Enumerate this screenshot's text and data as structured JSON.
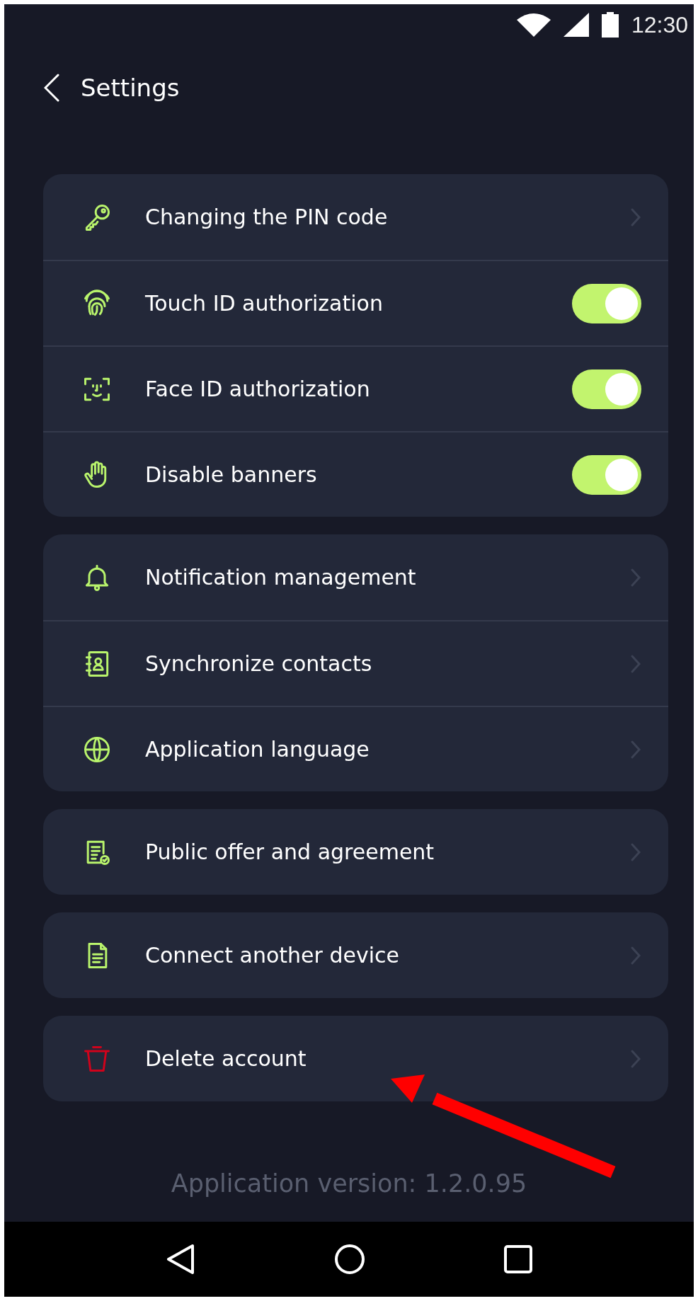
{
  "status_bar": {
    "time": "12:30"
  },
  "header": {
    "title": "Settings"
  },
  "groups": [
    {
      "items": [
        {
          "kind": "link",
          "label": "Changing the PIN code"
        },
        {
          "kind": "toggle",
          "label": "Touch ID authorization",
          "on": true
        },
        {
          "kind": "toggle",
          "label": "Face ID authorization",
          "on": true
        },
        {
          "kind": "toggle",
          "label": "Disable banners",
          "on": true
        }
      ]
    },
    {
      "items": [
        {
          "kind": "link",
          "label": "Notification management"
        },
        {
          "kind": "link",
          "label": "Synchronize contacts"
        },
        {
          "kind": "link",
          "label": "Application language"
        }
      ]
    },
    {
      "items": [
        {
          "kind": "link",
          "label": "Public offer and agreement"
        }
      ]
    },
    {
      "items": [
        {
          "kind": "link",
          "label": "Connect another device"
        }
      ]
    },
    {
      "items": [
        {
          "kind": "link",
          "label": "Delete account"
        }
      ]
    }
  ],
  "footer": {
    "version": "Application version: 1.2.0.95"
  }
}
